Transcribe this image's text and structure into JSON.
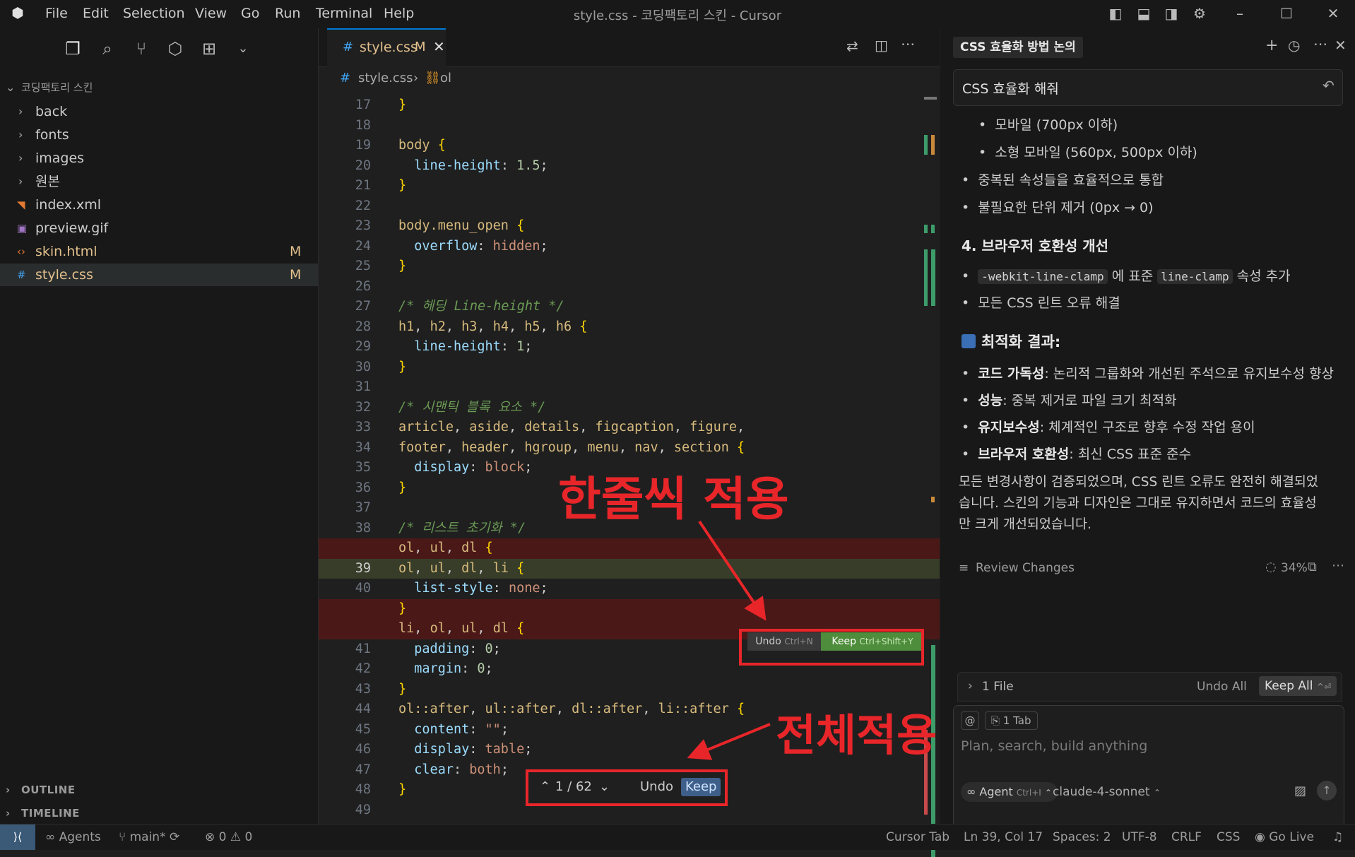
{
  "titlebar": {
    "menu": [
      "File",
      "Edit",
      "Selection",
      "View",
      "Go",
      "Run",
      "Terminal",
      "Help"
    ],
    "window_title": "style.css - 코딩팩토리 스킨 - Cursor"
  },
  "sidebar": {
    "root": "코딩팩토리 스킨",
    "items": [
      {
        "label": "back",
        "kind": "folder",
        "badge": ""
      },
      {
        "label": "fonts",
        "kind": "folder",
        "badge": ""
      },
      {
        "label": "images",
        "kind": "folder",
        "badge": ""
      },
      {
        "label": "원본",
        "kind": "folder",
        "badge": ""
      },
      {
        "label": "index.xml",
        "kind": "xml",
        "badge": ""
      },
      {
        "label": "preview.gif",
        "kind": "image",
        "badge": ""
      },
      {
        "label": "skin.html",
        "kind": "html",
        "badge": "M"
      },
      {
        "label": "style.css",
        "kind": "css",
        "badge": "M"
      }
    ],
    "outline": "OUTLINE",
    "timeline": "TIMELINE"
  },
  "editor": {
    "tab_label": "style.css",
    "tab_badge": "M",
    "breadcrumb_file": "style.css",
    "breadcrumb_symbol": "ol",
    "hunk_undo": "Undo",
    "hunk_undo_shortcut": "Ctrl+N",
    "hunk_keep": "Keep",
    "hunk_keep_shortcut": "Ctrl+Shift+Y",
    "nav_counter": "1 / 62",
    "nav_undo": "Undo",
    "nav_keep": "Keep",
    "lines": [
      {
        "n": "17",
        "t": "}"
      },
      {
        "n": "18",
        "t": ""
      },
      {
        "n": "19",
        "t": "body {"
      },
      {
        "n": "20",
        "t": "  line-height: 1.5;"
      },
      {
        "n": "21",
        "t": "}"
      },
      {
        "n": "22",
        "t": ""
      },
      {
        "n": "23",
        "t": "body.menu_open {"
      },
      {
        "n": "24",
        "t": "  overflow: hidden;"
      },
      {
        "n": "25",
        "t": "}"
      },
      {
        "n": "26",
        "t": ""
      },
      {
        "n": "27",
        "t": "/* 헤딩 Line-height */"
      },
      {
        "n": "28",
        "t": "h1, h2, h3, h4, h5, h6 {"
      },
      {
        "n": "29",
        "t": "  line-height: 1;"
      },
      {
        "n": "30",
        "t": "}"
      },
      {
        "n": "31",
        "t": ""
      },
      {
        "n": "32",
        "t": "/* 시맨틱 블록 요소 */"
      },
      {
        "n": "33",
        "t": "article, aside, details, figcaption, figure,"
      },
      {
        "n": "34",
        "t": "footer, header, hgroup, menu, nav, section {"
      },
      {
        "n": "35",
        "t": "  display: block;"
      },
      {
        "n": "36",
        "t": "}"
      },
      {
        "n": "37",
        "t": ""
      },
      {
        "n": "38",
        "t": "/* 리스트 초기화 */"
      },
      {
        "n": "",
        "t": "ol, ul, dl {"
      },
      {
        "n": "39",
        "t": "ol, ul, dl, li {"
      },
      {
        "n": "40",
        "t": "  list-style: none;"
      },
      {
        "n": "",
        "t": "}"
      },
      {
        "n": "",
        "t": "li, ol, ul, dl {"
      },
      {
        "n": "41",
        "t": "  padding: 0;"
      },
      {
        "n": "42",
        "t": "  margin: 0;"
      },
      {
        "n": "43",
        "t": "}"
      },
      {
        "n": "44",
        "t": "ol::after, ul::after, dl::after, li::after {"
      },
      {
        "n": "45",
        "t": "  content: \"\";"
      },
      {
        "n": "46",
        "t": "  display: table;"
      },
      {
        "n": "47",
        "t": "  clear: both;"
      },
      {
        "n": "48",
        "t": "}"
      },
      {
        "n": "49",
        "t": ""
      }
    ]
  },
  "annotations": {
    "line_apply": "한줄씩 적용",
    "all_apply": "전체적용"
  },
  "chat": {
    "tab_title": "CSS 효율화 방법 논의",
    "thread_title": "CSS 효율화 해줘",
    "sub_bullets": [
      "모바일 (700px 이하)",
      "소형 모바일 (560px, 500px 이하)"
    ],
    "bullets_a": [
      "중복된 속성들을 효율적으로 통합",
      "불필요한 단위 제거 (0px → 0)"
    ],
    "section4": "4. 브라우저 호환성 개선",
    "compat_code1": "-webkit-line-clamp",
    "compat_text1": "에 표준",
    "compat_code2": "line-clamp",
    "compat_text2": "속성 추가",
    "compat_b2": "모든 CSS 린트 오류 해결",
    "result_heading": "최적화 결과:",
    "results": [
      {
        "k": "코드 가독성",
        "v": ": 논리적 그룹화와 개선된 주석으로 유지보수성 향상"
      },
      {
        "k": "성능",
        "v": ": 중복 제거로 파일 크기 최적화"
      },
      {
        "k": "유지보수성",
        "v": ": 체계적인 구조로 향후 수정 작업 용이"
      },
      {
        "k": "브라우저 호환성",
        "v": ": 최신 CSS 표준 준수"
      }
    ],
    "summary_1": "모든 변경사항이 검증되었으며, CSS 린트 오류도 완전히 해결되었",
    "summary_2": "습니다. 스킨의 기능과 디자인은 그대로 유지하면서 코드의 효율성",
    "summary_3": "만 크게 개선되었습니다.",
    "review_changes": "Review Changes",
    "progress": "34%",
    "files_count": "1 File",
    "undo_all": "Undo All",
    "keep_all": "Keep All",
    "context_tab": "1 Tab",
    "input_placeholder": "Plan, search, build anything",
    "mode": "Agent",
    "mode_shortcut": "Ctrl+I",
    "model": "claude-4-sonnet"
  },
  "statusbar": {
    "agents": "Agents",
    "branch": "main*",
    "errors": "0",
    "warnings": "0",
    "cursor_tab": "Cursor Tab",
    "position": "Ln 39, Col 17",
    "spaces": "Spaces: 2",
    "encoding": "UTF-8",
    "eol": "CRLF",
    "language": "CSS",
    "golive": "Go Live"
  },
  "colors": {
    "accent": "#0078d4",
    "removed": "#4b1818",
    "added": "#373d29",
    "annotation": "#e8262a"
  }
}
